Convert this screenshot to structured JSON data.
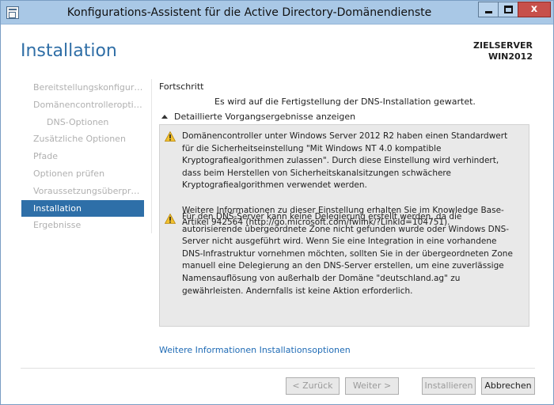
{
  "window": {
    "title": "Konfigurations-Assistent für die Active Directory-Domänendienste",
    "close_glyph": "x"
  },
  "header": {
    "title": "Installation",
    "target_label": "ZIELSERVER",
    "target_name": "WIN2012"
  },
  "nav": {
    "items": [
      {
        "label": "Bereitstellungskonfigurati..."
      },
      {
        "label": "Domänencontrolleroption..."
      },
      {
        "label": "DNS-Optionen"
      },
      {
        "label": "Zusätzliche Optionen"
      },
      {
        "label": "Pfade"
      },
      {
        "label": "Optionen prüfen"
      },
      {
        "label": "Voraussetzungsüberprüfu..."
      },
      {
        "label": "Installation"
      },
      {
        "label": "Ergebnisse"
      }
    ]
  },
  "content": {
    "section_label": "Fortschritt",
    "status": "Es wird auf die Fertigstellung der DNS-Installation gewartet.",
    "toggle_label": "Detaillierte Vorgangsergebnisse anzeigen",
    "messages": [
      {
        "p1": "Domänencontroller unter Windows Server 2012 R2 haben einen Standardwert für die Sicherheitseinstellung \"Mit Windows NT 4.0 kompatible Kryptografiealgorithmen zulassen\". Durch diese Einstellung wird verhindert, dass beim Herstellen von Sicherheitskanalsitzungen schwächere Kryptografiealgorithmen verwendet werden.",
        "p2": "Weitere Informationen zu dieser Einstellung erhalten Sie im Knowledge Base-Artikel 942564 (http://go.microsoft.com/fwlink/?LinkId=104751)."
      },
      {
        "p1": "Für den DNS-Server kann keine Delegierung erstellt werden, da die autorisierende übergeordnete Zone nicht gefunden wurde oder Windows DNS-Server nicht ausgeführt wird. Wenn Sie eine Integration in eine vorhandene DNS-Infrastruktur vornehmen möchten, sollten Sie in der übergeordneten Zone manuell eine Delegierung an den DNS-Server erstellen, um eine zuverlässige Namensauflösung von außerhalb der Domäne \"deutschland.ag\" zu gewährleisten. Andernfalls ist keine Aktion erforderlich."
      }
    ],
    "more_link": "Weitere Informationen Installationsoptionen"
  },
  "footer": {
    "back": "< Zurück",
    "next": "Weiter >",
    "install": "Installieren",
    "cancel": "Abbrechen"
  },
  "colors": {
    "accent": "#2e6fa8",
    "title_blue": "#2f6ea6",
    "link": "#1f6bb5",
    "warning": "#f2c12e"
  }
}
